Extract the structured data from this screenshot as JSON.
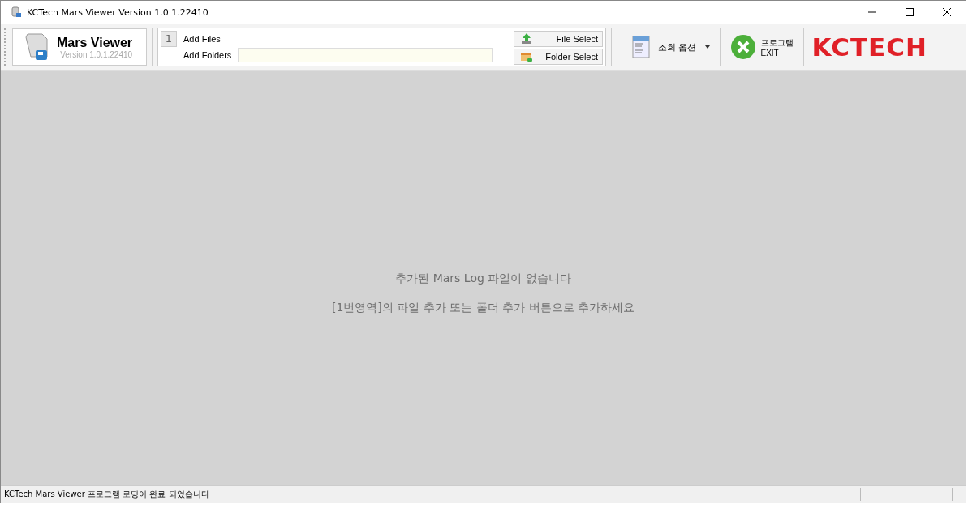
{
  "window": {
    "title": "KCTech Mars Viewer Version 1.0.1.22410"
  },
  "app_header": {
    "name": "Mars Viewer",
    "version": "Version 1.0.1.22410"
  },
  "area_1": {
    "number": "1",
    "add_files": "Add Files",
    "add_folders": "Add Folders",
    "file_select": "File Select",
    "folder_select": "Folder Select"
  },
  "options_menu": {
    "label": "조회 옵션"
  },
  "exit_button": {
    "label": "프로그램",
    "sublabel": "EXIT"
  },
  "logo": {
    "text": "KCTECH"
  },
  "empty_message": {
    "title": "추가된 Mars Log 파일이 없습니다",
    "hint": "[1번영역]의 파일 추가 또는 폴더 추가 버튼으로 추가하세요"
  },
  "status_bar": {
    "text": "KCTech Mars Viewer 프로그램 로딩이 완료 되었습니다"
  }
}
